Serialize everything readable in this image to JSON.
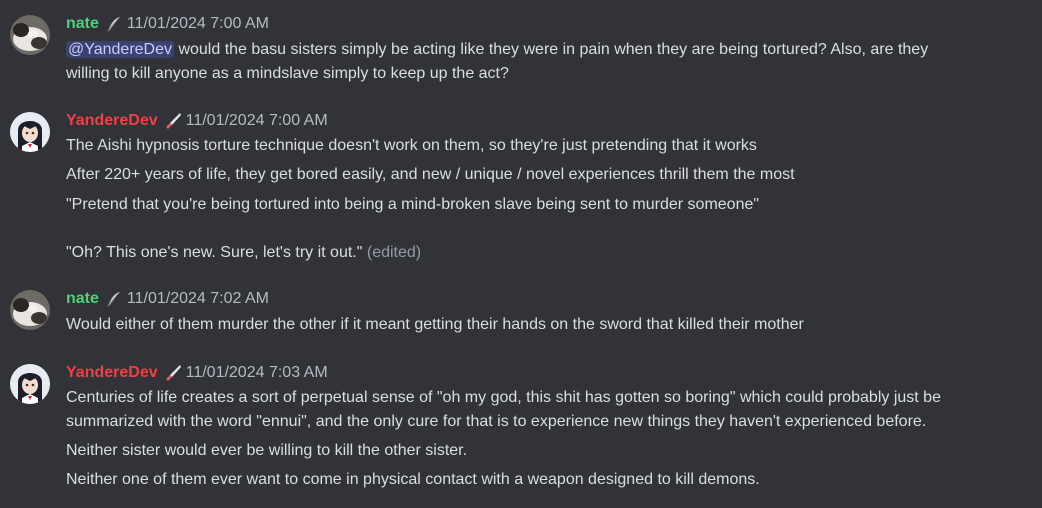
{
  "messages": [
    {
      "username": "nate",
      "timestamp": "11/01/2024 7:00 AM",
      "avatar_icon": "cat-avatar",
      "role_icon": "feather-icon",
      "mention": "@YandereDev",
      "lines": [
        " would the basu sisters simply be acting like they were in pain when they are being tortured? Also, are they",
        "willing to kill anyone as a mindslave simply to keep up the act?"
      ]
    },
    {
      "username": "YandereDev",
      "timestamp": "11/01/2024 7:00 AM",
      "avatar_icon": "anime-girl-avatar",
      "role_icon": "knife-icon",
      "lines": [
        "The Aishi hypnosis torture technique doesn't work on them, so they're just pretending that it works",
        "After 220+ years of life, they get bored easily, and new / unique / novel experiences thrill them the most",
        "\"Pretend that you're being tortured into being a mind-broken slave being sent to murder someone\"",
        "\"Oh? This one's new. Sure, let's try it out.\""
      ],
      "edited": "(edited)"
    },
    {
      "username": "nate",
      "timestamp": "11/01/2024 7:02 AM",
      "avatar_icon": "cat-avatar",
      "role_icon": "feather-icon",
      "lines": [
        "Would either of them murder the other if it meant getting their hands on the sword that killed their mother"
      ]
    },
    {
      "username": "YandereDev",
      "timestamp": "11/01/2024 7:03 AM",
      "avatar_icon": "anime-girl-avatar",
      "role_icon": "knife-icon",
      "lines": [
        "Centuries of life creates a sort of perpetual sense of \"oh my god, this shit has gotten so boring\" which could probably just be",
        "summarized with the word \"ennui\", and the only cure for that is to experience new things they haven't experienced before.",
        "Neither sister would ever be willing to kill the other sister.",
        "Neither one of them ever want to come in physical contact with a weapon designed to kill demons."
      ]
    }
  ]
}
